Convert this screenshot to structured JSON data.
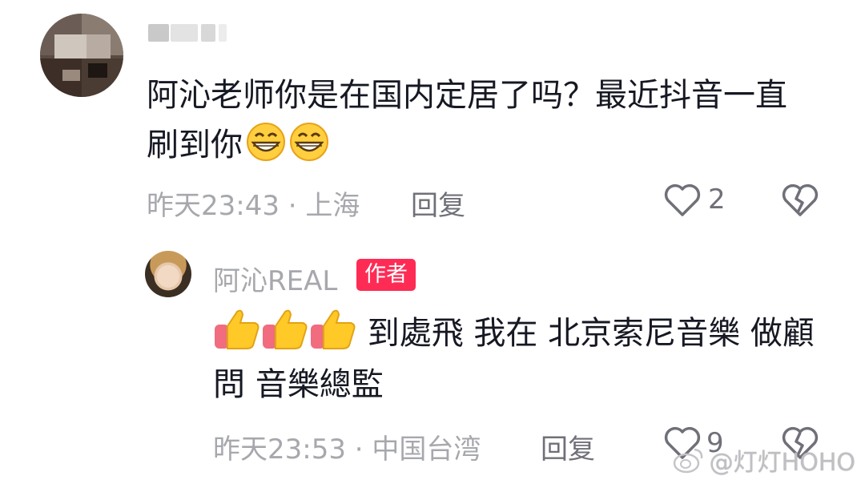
{
  "colors": {
    "text": "#161823",
    "meta": "#a7a8ad",
    "action": "#6f7078",
    "author_badge": "#fe2c55"
  },
  "top_comment": {
    "avatar": "pixelated-avatar",
    "username": "",
    "text": "阿沁老师你是在国内定居了吗？最近抖音一直刷到你",
    "emojis": [
      "grin-emoji",
      "grin-emoji"
    ],
    "time": "昨天23:43 · 上海",
    "reply_label": "回复",
    "likes": "2",
    "like_icon": "heart-outline-icon",
    "dislike_icon": "broken-heart-icon"
  },
  "reply_comment": {
    "avatar": "user-photo-avatar",
    "username": "阿沁REAL",
    "badge": "作者",
    "emojis": [
      "thumbs-up-emoji",
      "thumbs-up-emoji",
      "thumbs-up-emoji"
    ],
    "text": "到處飛 我在 北京索尼音樂 做顧問 音樂總監",
    "time": "昨天23:53 · 中国台湾",
    "reply_label": "回复",
    "likes": "9",
    "like_icon": "heart-outline-icon",
    "dislike_icon": "broken-heart-icon"
  },
  "watermark": {
    "icon": "weibo-icon",
    "text": "@灯灯HOHO"
  }
}
